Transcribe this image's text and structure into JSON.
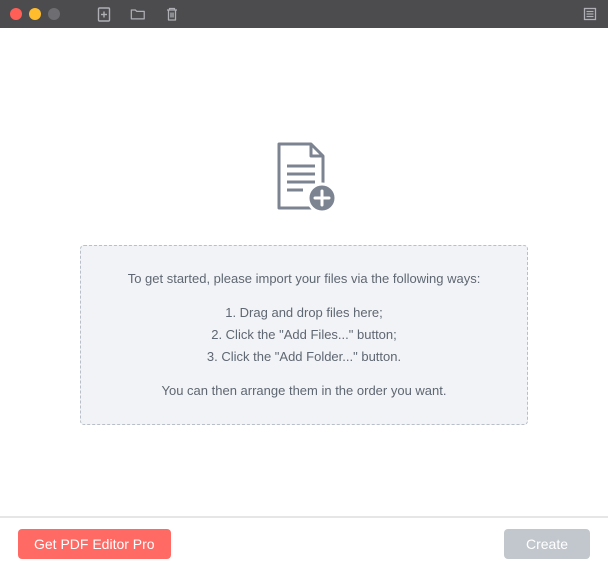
{
  "info": {
    "intro": "To get started, please import your files via the following ways:",
    "step1": "1. Drag and drop files here;",
    "step2": "2. Click the \"Add Files...\" button;",
    "step3": "3. Click the \"Add Folder...\" button.",
    "outro": "You can then arrange them in the order you want."
  },
  "footer": {
    "get_pro_label": "Get PDF Editor Pro",
    "create_label": "Create"
  }
}
